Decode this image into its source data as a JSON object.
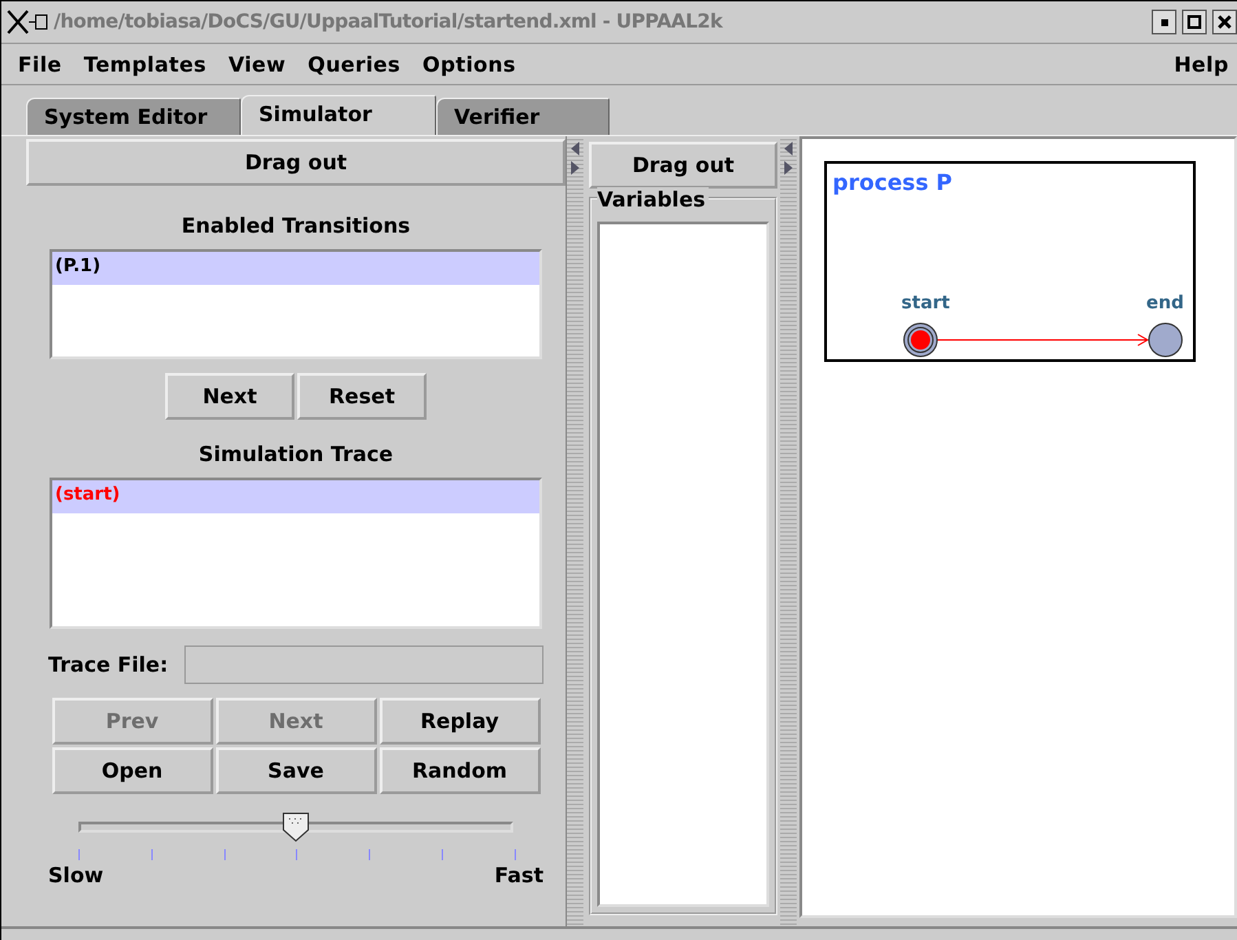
{
  "window": {
    "title": "/home/tobiasa/DoCS/GU/UppaalTutorial/startend.xml - UPPAAL2k"
  },
  "menu": [
    {
      "label": "File"
    },
    {
      "label": "Templates"
    },
    {
      "label": "View"
    },
    {
      "label": "Queries"
    },
    {
      "label": "Options"
    }
  ],
  "help_menu": {
    "label": "Help"
  },
  "tabs": [
    {
      "label": "System Editor",
      "selected": false
    },
    {
      "label": "Simulator",
      "selected": true
    },
    {
      "label": "Verifier",
      "selected": false
    }
  ],
  "simulator": {
    "drag_out": "Drag out",
    "enabled_transitions": {
      "title": "Enabled Transitions",
      "items": [
        {
          "label": "(P.1)",
          "selected": true
        }
      ]
    },
    "transition_buttons": [
      {
        "label": "Next",
        "disabled": false
      },
      {
        "label": "Reset",
        "disabled": false
      }
    ],
    "simulation_trace": {
      "title": "Simulation Trace",
      "items": [
        {
          "label": "(start)",
          "selected": true
        }
      ]
    },
    "trace_file": {
      "label": "Trace File:"
    },
    "trace_buttons": [
      {
        "label": "Prev",
        "disabled": true
      },
      {
        "label": "Next",
        "disabled": true
      },
      {
        "label": "Replay",
        "disabled": false
      },
      {
        "label": "Open",
        "disabled": false
      },
      {
        "label": "Save",
        "disabled": false
      },
      {
        "label": "Random",
        "disabled": false
      }
    ],
    "speed": {
      "level": 0.5,
      "min_label": "Slow",
      "max_label": "Fast"
    }
  },
  "variables_panel": {
    "drag_out": "Drag out",
    "title": "Variables"
  },
  "process": {
    "title": "process P",
    "locations": [
      {
        "name": "start",
        "current": true,
        "initial": true
      },
      {
        "name": "end",
        "current": false,
        "initial": false
      }
    ]
  }
}
